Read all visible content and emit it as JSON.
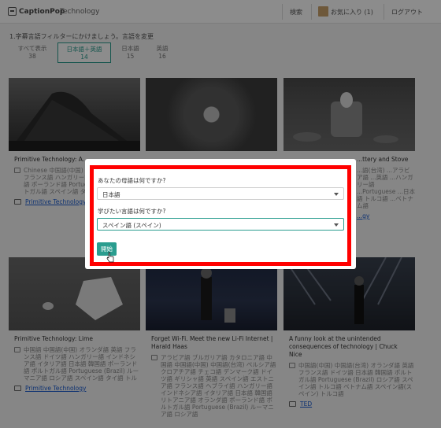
{
  "header": {
    "logo_text": "CaptionPop",
    "category": "Technology",
    "search_label": "検索",
    "favorites_label": "お気に入り (1)",
    "logout_label": "ログアウト",
    "favorites_color": "#c9a06a"
  },
  "filter": {
    "note": "1.字幕言語フィルターにかけましょう。言語を変更",
    "tabs": [
      {
        "label": "すべて表示",
        "count": "38"
      },
      {
        "label": "日本語＋英語",
        "count": "14"
      },
      {
        "label": "日本語",
        "count": "15"
      },
      {
        "label": "英語",
        "count": "16"
      }
    ]
  },
  "cards": [
    {
      "title": "Primitive Technology: A...",
      "langs": "Chinese 中国語(中国) オランダ語 ドイツ語 フランス語 ハンガリー語 イタリア語 日本語 ポーランド語 Portuguese (Brazil) ポルトガル語 スペイン語 タイ語 トルコ語",
      "channel": "Primitive Technology"
    },
    {
      "title": "",
      "langs": "",
      "channel": ""
    },
    {
      "title": "...ttery and Stove",
      "langs": "...語(台湾) ...アラビア語 ...英語 ...ハンガリー語 ...Portuguese ...日本語 トルコ語 ...ベトナム語",
      "channel": "...gy"
    },
    {
      "title": "Primitive Technology: Lime",
      "langs": "中国語 中国語(中国) オランダ語 英語 フランス語 ドイツ語 ハンガリー語 インドネシア語 イタリア語 日本語 韓国語 ポーランド語 ポルトガル語 Portuguese (Brazil) ルーマニア語 ロシア語 スペイン語 タイ語 トルコ語 ベトナム語",
      "channel": "Primitive Technology"
    },
    {
      "title": "Forget Wi-Fi. Meet the new Li-Fi Internet | Harald Haas",
      "langs": "アラビア語 ブルガリア語 カタロニア語 中国語 中国語(中国) 中国語(台湾) ペルシア語 クロアチア語 チェコ語 デンマーク語 ドイツ語 ギリシャ語 英語 スペイン語 エストニア語 フランス語 ヘブライ語 ハンガリー語 インドネシア語 イタリア語 日本語 韓国語 リトアニア語 オランダ語 ポーランド語 ポルトガル語 Portuguese (Brazil) ルーマニア語 ロシア語",
      "channel": ""
    },
    {
      "title": "A funny look at the unintended consequences of technology | Chuck Nice",
      "langs": "中国語(中国) 中国語(台湾) オランダ語 英語 フランス語 ドイツ語 日本語 韓国語 ポルトガル語 Portuguese (Brazil) ロシア語 スペイン語 トルコ語 ベトナム語 スペイン語(スペイン) トルコ語",
      "channel": "TED"
    }
  ],
  "modal": {
    "native_question": "あなたの母語は何ですか?",
    "native_value": "日本語",
    "learn_question": "学びたい言語は何ですか?",
    "learn_value": "スペイン語 (スペイン)",
    "start_label": "開始",
    "highlight_color": "#ff0000",
    "accent_color": "#2a9d8f"
  }
}
